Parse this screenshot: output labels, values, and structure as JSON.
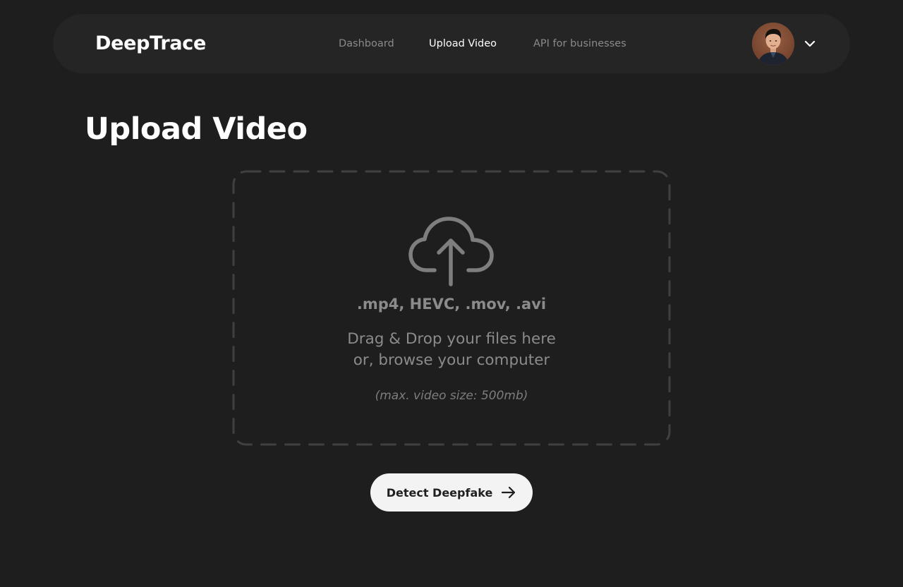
{
  "app": {
    "logo": "DeepTrace"
  },
  "nav": {
    "items": [
      {
        "label": "Dashboard",
        "active": false
      },
      {
        "label": "Upload Video",
        "active": true
      },
      {
        "label": "API for businesses",
        "active": false
      }
    ]
  },
  "user": {
    "avatar_icon": "user-avatar",
    "menu_icon": "chevron-down-icon"
  },
  "page": {
    "title": "Upload Video"
  },
  "upload": {
    "icon": "cloud-upload-icon",
    "formats": ".mp4, HEVC, .mov, .avi",
    "instructions_line1": "Drag & Drop your files here",
    "instructions_line2": "or, browse your computer",
    "max_size": "(max. video size: 500mb)"
  },
  "actions": {
    "detect_label": "Detect Deepfake",
    "detect_icon": "arrow-right-icon"
  },
  "colors": {
    "background": "#1e1e1e",
    "navbar": "#252525",
    "muted_text": "#8b8b8b",
    "button_bg": "#f3f3f3",
    "button_text": "#1f1f1f"
  }
}
